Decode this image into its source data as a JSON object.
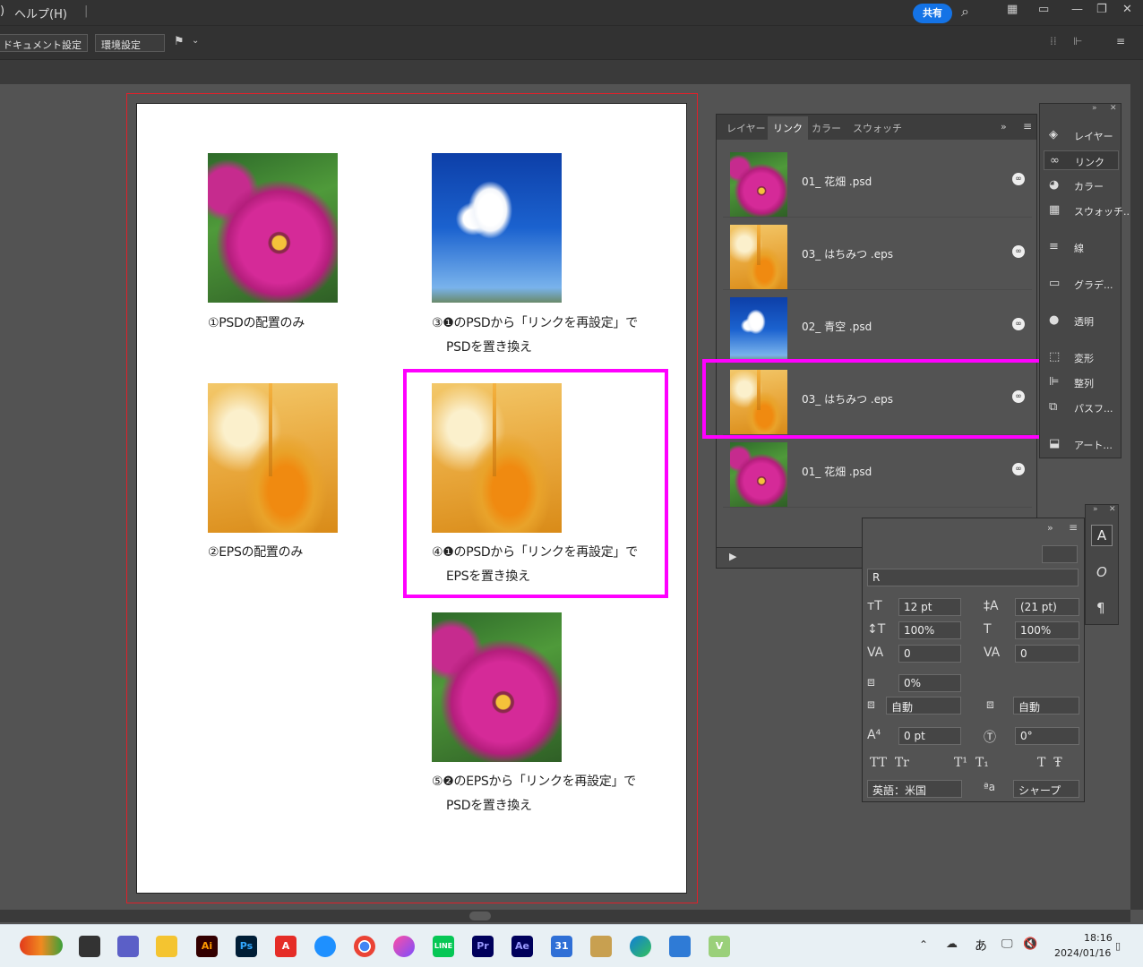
{
  "menubar": {
    "help_menu": "ヘルプ(H)",
    "share_button": "共有"
  },
  "toolbar": {
    "document_setup": "ドキュメント設定",
    "preferences": "環境設定"
  },
  "artboard": {
    "captions": [
      "①PSDの配置のみ",
      "③❶のPSDから「リンクを再設定」で",
      "PSDを置き換え",
      "②EPSの配置のみ",
      "④❶のPSDから「リンクを再設定」で",
      "EPSを置き換え",
      "⑤❷のEPSから「リンクを再設定」で",
      "PSDを置き換え"
    ]
  },
  "links_panel": {
    "tabs": [
      "レイヤー",
      "リンク",
      "カラー",
      "スウォッチ"
    ],
    "active_tab": "リンク",
    "items": [
      {
        "name": "01_ 花畑 .psd",
        "thumb": "flower"
      },
      {
        "name": "03_ はちみつ .eps",
        "thumb": "honey"
      },
      {
        "name": "02_ 青空 .psd",
        "thumb": "sky"
      },
      {
        "name": "03_ はちみつ .eps",
        "thumb": "honey",
        "highlighted": true
      },
      {
        "name": "01_ 花畑 .psd",
        "thumb": "flower"
      }
    ]
  },
  "dock": {
    "items": [
      "レイヤー",
      "リンク",
      "カラー",
      "スウォッチ...",
      "線",
      "グラデ...",
      "透明",
      "変形",
      "整列",
      "パスフ...",
      "アート..."
    ],
    "selected": "リンク"
  },
  "character_panel": {
    "font_style": "R",
    "font_size": "12 pt",
    "leading": "(21 pt)",
    "vertical_scale": "100%",
    "horizontal_scale": "100%",
    "kerning": "0",
    "tracking": "0",
    "tsume": "0%",
    "aki_left": "自動",
    "aki_right": "自動",
    "baseline_shift": "0 pt",
    "rotation": "0°",
    "language": "英語：米国",
    "antialias": "シャープ"
  },
  "taskbar": {
    "time": "18:16",
    "date": "2024/01/16",
    "ime": "あ"
  },
  "colors": {
    "highlight": "#ff00ff",
    "artboard_border": "#e0202a",
    "share_blue": "#1473e6"
  }
}
